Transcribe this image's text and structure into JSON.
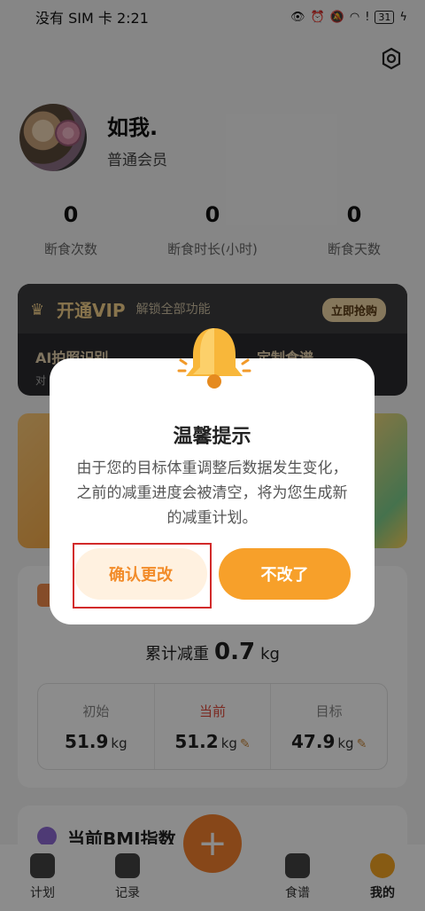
{
  "status_bar": {
    "carrier": "没有 SIM 卡",
    "time": "2:21",
    "battery": "31"
  },
  "profile": {
    "nickname": "如我.",
    "member_level": "普通会员"
  },
  "stats": [
    {
      "value": "0",
      "label": "断食次数"
    },
    {
      "value": "0",
      "label": "断食时长(小时)"
    },
    {
      "value": "0",
      "label": "断食天数"
    }
  ],
  "vip": {
    "title": "开通VIP",
    "subtitle": "解锁全部功能",
    "button": "立即抢购",
    "feature_1": "AI拍照识别",
    "feature_2": "定制食谱",
    "small": "对"
  },
  "progress": {
    "total_label": "累计减重",
    "total_value": "0.7",
    "total_unit": "kg",
    "initial_label": "初始",
    "initial_value": "51.9",
    "current_label": "当前",
    "current_value": "51.2",
    "target_label": "目标",
    "target_value": "47.9",
    "unit": "kg"
  },
  "bmi": {
    "title": "当前BMI指数"
  },
  "tabs": [
    {
      "label": "计划"
    },
    {
      "label": "记录"
    },
    {
      "label": "食谱"
    },
    {
      "label": "我的"
    }
  ],
  "fab": {
    "symbol": "+"
  },
  "dialog": {
    "title": "温馨提示",
    "message": "由于您的目标体重调整后数据发生变化，之前的减重进度会被清空，将为您生成新的减重计划。",
    "confirm": "确认更改",
    "cancel": "不改了"
  },
  "colors": {
    "accent": "#f7a02a",
    "confirm_text": "#f28c2a",
    "highlight": "#d22a2a"
  }
}
